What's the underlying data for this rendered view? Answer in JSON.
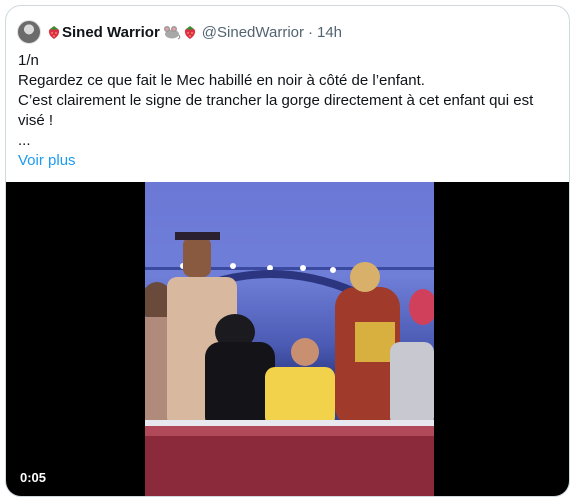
{
  "tweet": {
    "display_name": "Sined Warrior",
    "handle": "@SinedWarrior",
    "separator": "·",
    "timestamp": "14h",
    "lines": [
      "1/n",
      "Regardez ce que fait le Mec habillé en noir à côté de l’enfant.",
      "C’est clairement le signe de trancher la gorge directement à cet enfant qui est visé !",
      "..."
    ],
    "see_more": "Voir plus"
  },
  "media": {
    "duration": "0:05"
  },
  "colors": {
    "link": "#1d9bf0",
    "text": "#0f1419",
    "secondary": "#536471",
    "border": "#cfd9de"
  },
  "icons": [
    "strawberry-emoji",
    "mouse-emoji",
    "strawberry-emoji"
  ]
}
